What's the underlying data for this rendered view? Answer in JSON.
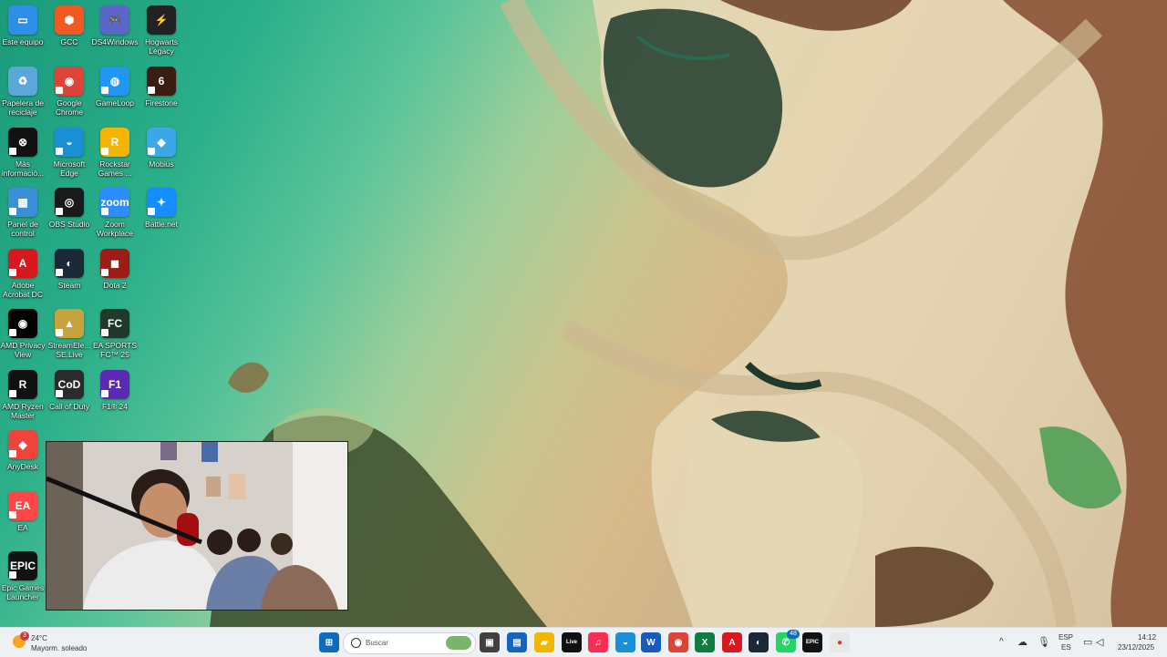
{
  "desktop": {
    "icons": [
      {
        "label": "Este equipo",
        "glyph": "▭",
        "color": "#2f8fe6"
      },
      {
        "label": "GCC",
        "glyph": "⬢",
        "color": "#f05a22"
      },
      {
        "label": "DS4Windows",
        "glyph": "🎮",
        "color": "#5a67c8"
      },
      {
        "label": "Hogwarts Legacy",
        "glyph": "⚡",
        "color": "#222222"
      },
      {
        "label": "Papelera de reciclaje",
        "glyph": "♻",
        "color": "#5aa7d8"
      },
      {
        "label": "Google Chrome",
        "glyph": "◉",
        "color": "#db4437"
      },
      {
        "label": "GameLoop",
        "glyph": "◍",
        "color": "#2196f3"
      },
      {
        "label": "Firestone",
        "glyph": "6",
        "color": "#3a1c10"
      },
      {
        "label": "Más informació...",
        "glyph": "⊗",
        "color": "#111111"
      },
      {
        "label": "Microsoft Edge",
        "glyph": "◒",
        "color": "#1b8fd6"
      },
      {
        "label": "Rockstar Games ...",
        "glyph": "R",
        "color": "#f5b400"
      },
      {
        "label": "Mobius",
        "glyph": "◆",
        "color": "#3ca7e6"
      },
      {
        "label": "Panel de control",
        "glyph": "▦",
        "color": "#3b8fd6"
      },
      {
        "label": "OBS Studio",
        "glyph": "◎",
        "color": "#1a1a1a"
      },
      {
        "label": "Zoom Workplace",
        "glyph": "zoom",
        "color": "#2d8cff"
      },
      {
        "label": "Battle.net",
        "glyph": "✦",
        "color": "#148eff"
      },
      {
        "label": "Adobe Acrobat DC",
        "glyph": "A",
        "color": "#d7191f"
      },
      {
        "label": "Steam",
        "glyph": "◐",
        "color": "#1b2838"
      },
      {
        "label": "Dota 2",
        "glyph": "◼",
        "color": "#9e1b16"
      },
      {
        "label": "",
        "glyph": "",
        "color": "transparent"
      },
      {
        "label": "AMD Privacy View",
        "glyph": "◉",
        "color": "#000000"
      },
      {
        "label": "StreamEle... SE.Live",
        "glyph": "▲",
        "color": "#c8a23c"
      },
      {
        "label": "EA SPORTS FC™ 25",
        "glyph": "FC",
        "color": "#1f3a2a"
      },
      {
        "label": "",
        "glyph": "",
        "color": "transparent"
      },
      {
        "label": "AMD Ryzen Master",
        "glyph": "R",
        "color": "#111111"
      },
      {
        "label": "Call of Duty",
        "glyph": "CoD",
        "color": "#2b2b2b"
      },
      {
        "label": "F1® 24",
        "glyph": "F1",
        "color": "#5a2ab2"
      },
      {
        "label": "",
        "glyph": "",
        "color": "transparent"
      },
      {
        "label": "AnyDesk",
        "glyph": "◆",
        "color": "#ef443b"
      },
      {
        "label": "",
        "glyph": "",
        "color": "transparent"
      },
      {
        "label": "",
        "glyph": "",
        "color": "transparent"
      },
      {
        "label": "",
        "glyph": "",
        "color": "transparent"
      },
      {
        "label": "EA",
        "glyph": "EA",
        "color": "#ff4747"
      },
      {
        "label": "",
        "glyph": "",
        "color": "transparent"
      },
      {
        "label": "",
        "glyph": "",
        "color": "transparent"
      },
      {
        "label": "",
        "glyph": "",
        "color": "transparent"
      },
      {
        "label": "Epic Games Launcher",
        "glyph": "EPIC",
        "color": "#121212"
      }
    ]
  },
  "taskbar": {
    "weather": {
      "temp": "24°C",
      "condition": "Mayorm. soleado",
      "badge": "3"
    },
    "search_placeholder": "Buscar",
    "apps": [
      {
        "name": "start-button",
        "glyph": "⊞",
        "color": "#0f6cbd"
      },
      {
        "name": "app-task-view",
        "glyph": "▣",
        "color": "#404040"
      },
      {
        "name": "app-store",
        "glyph": "▤",
        "color": "#1565c0"
      },
      {
        "name": "app-file-explorer",
        "glyph": "▰",
        "color": "#f2b600"
      },
      {
        "name": "app-live",
        "glyph": "Live",
        "color": "#111111"
      },
      {
        "name": "app-music",
        "glyph": "♫",
        "color": "#fa2d55"
      },
      {
        "name": "app-edge",
        "glyph": "◒",
        "color": "#1b8fd6"
      },
      {
        "name": "app-word",
        "glyph": "W",
        "color": "#185abd"
      },
      {
        "name": "app-chrome",
        "glyph": "◉",
        "color": "#db4437"
      },
      {
        "name": "app-excel",
        "glyph": "X",
        "color": "#107c41"
      },
      {
        "name": "app-acrobat",
        "glyph": "A",
        "color": "#d7191f"
      },
      {
        "name": "app-steam",
        "glyph": "◐",
        "color": "#1b2838"
      },
      {
        "name": "app-whatsapp",
        "glyph": "✆",
        "color": "#25d366",
        "badge": "48"
      },
      {
        "name": "app-epic",
        "glyph": "EPIC",
        "color": "#121212"
      },
      {
        "name": "app-paint",
        "glyph": "●",
        "color": "#e8e8e8"
      }
    ],
    "tray": {
      "language_top": "ESP",
      "language_bottom": "ES",
      "time": "14:12",
      "date": "23/12/2025"
    }
  }
}
